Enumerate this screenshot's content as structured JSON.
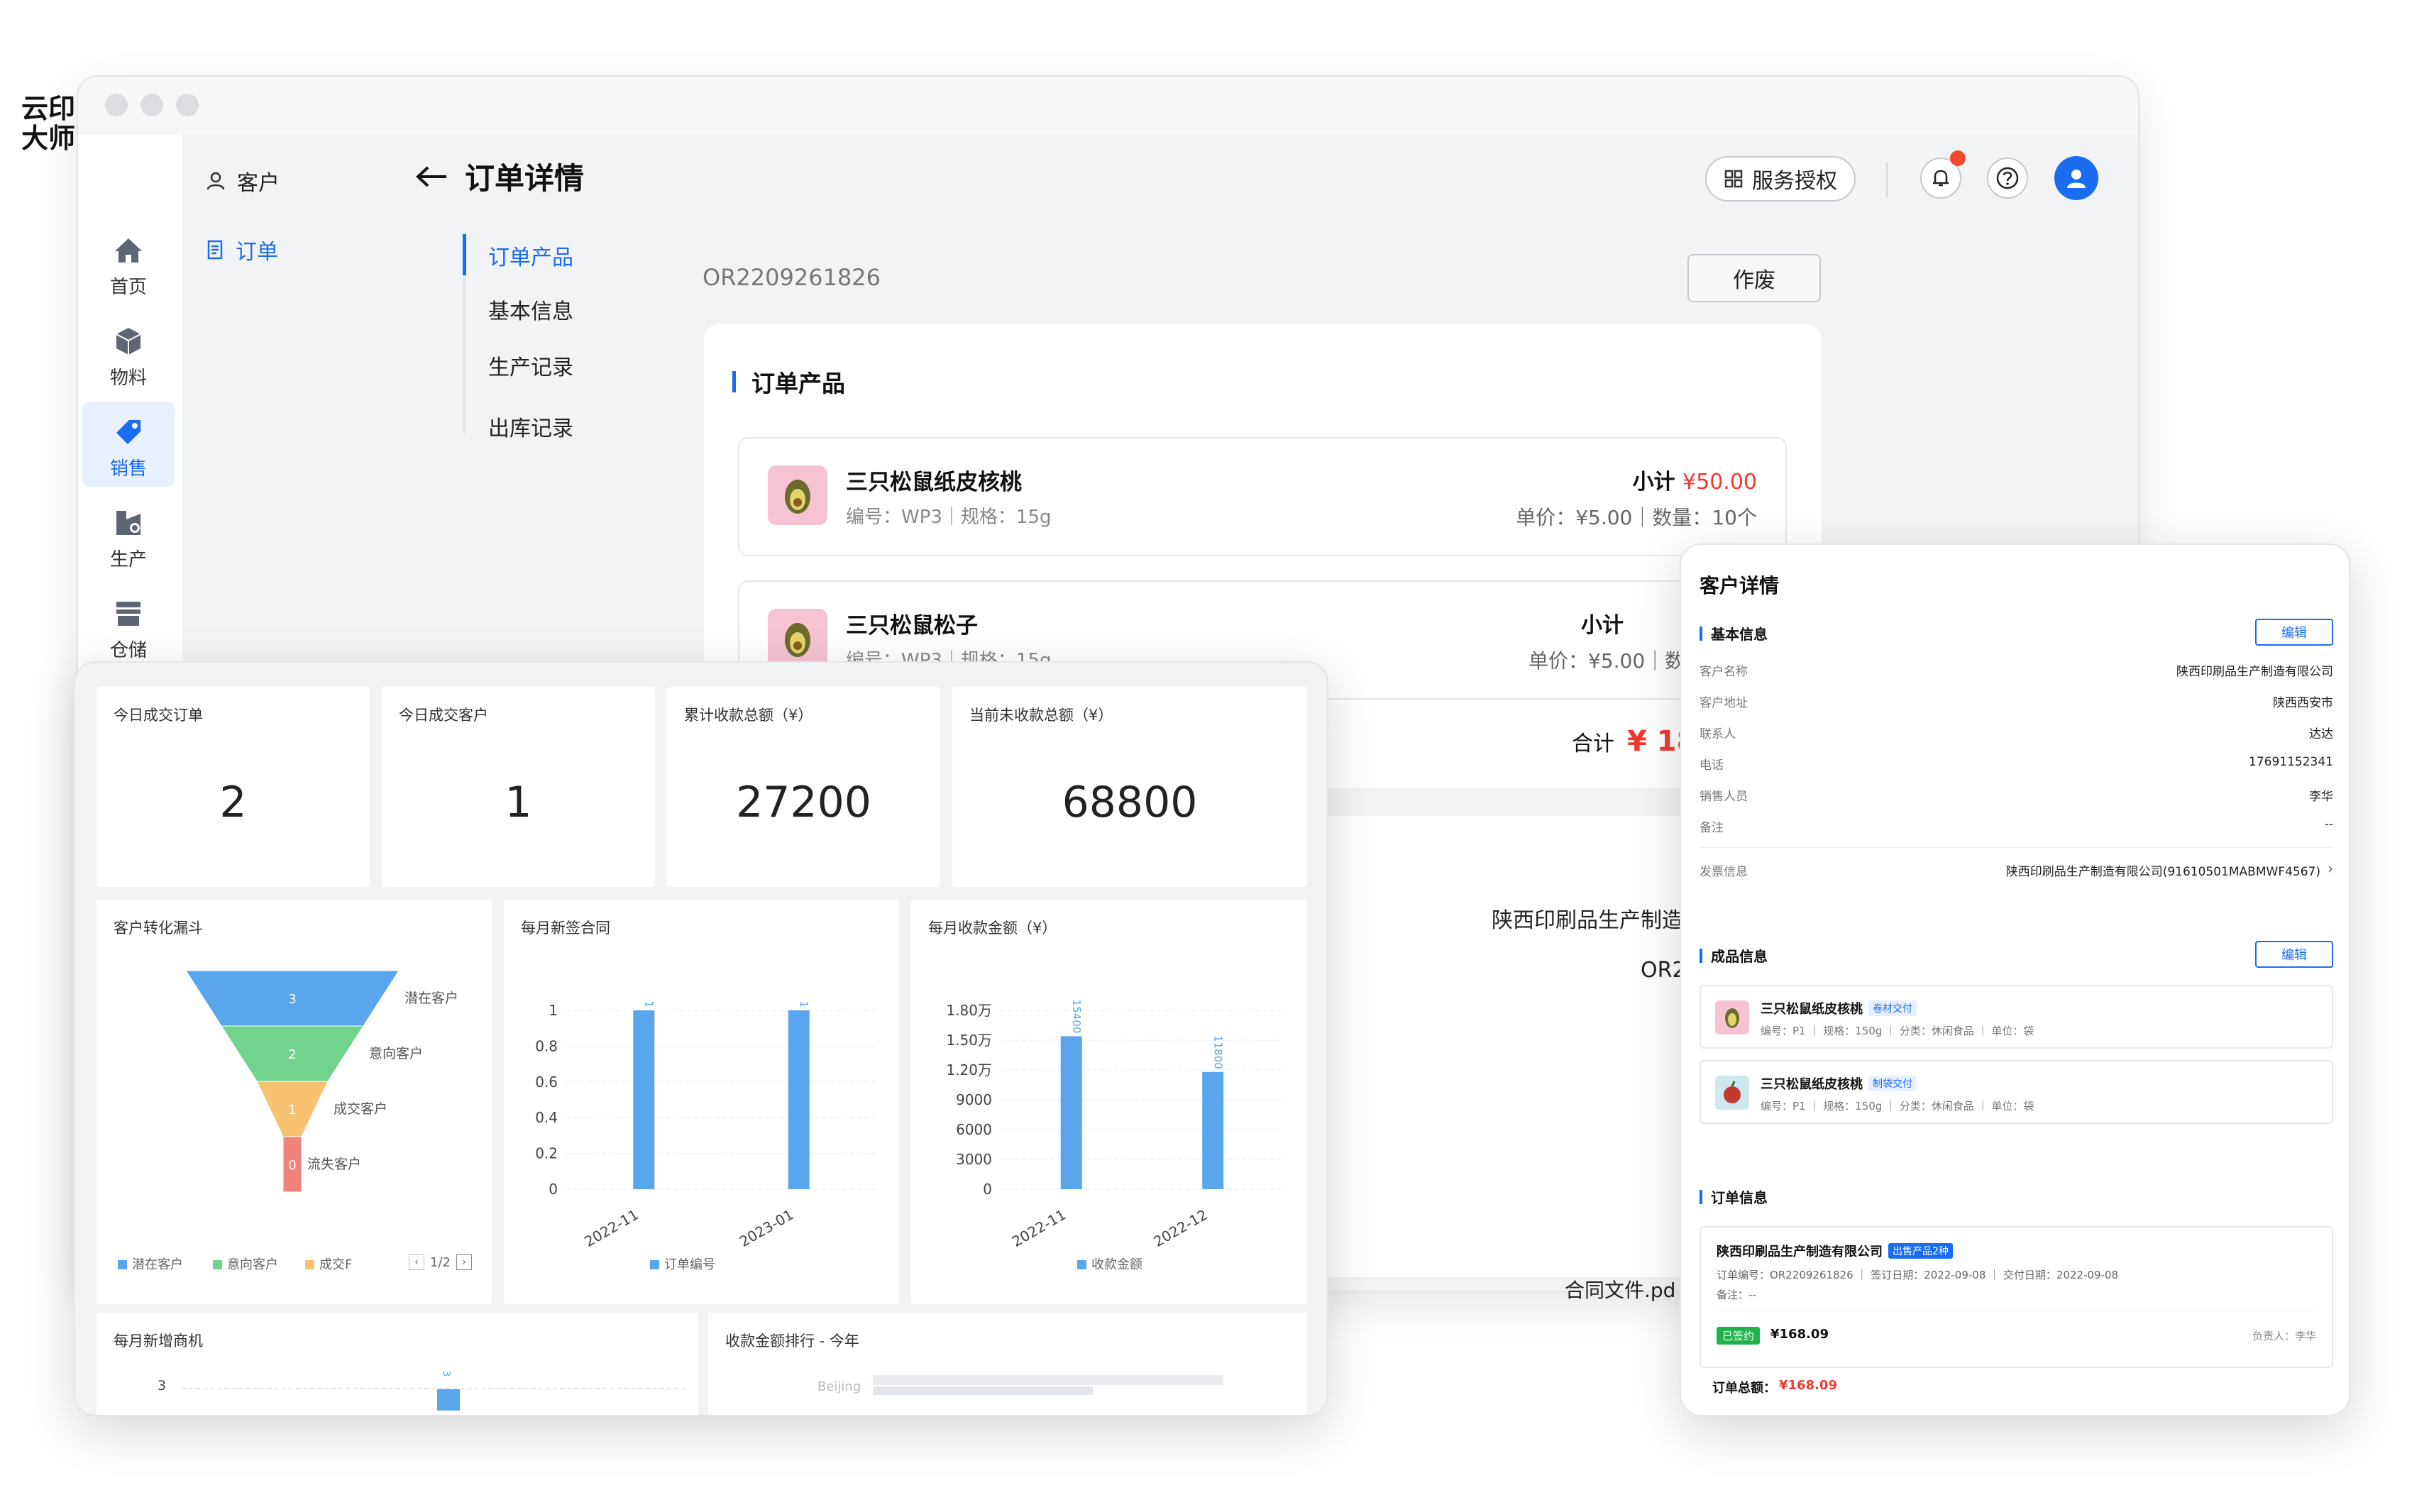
{
  "main": {
    "logo": "云印大师",
    "rail": [
      {
        "label": "首页",
        "icon": "home-icon"
      },
      {
        "label": "物料",
        "icon": "cube-icon"
      },
      {
        "label": "销售",
        "icon": "tag-icon"
      },
      {
        "label": "生产",
        "icon": "factory-icon"
      },
      {
        "label": "仓储",
        "icon": "store-icon"
      }
    ],
    "subnav": {
      "customer": "客户",
      "order": "订单"
    },
    "page_title": "订单详情",
    "anchors": [
      "订单产品",
      "基本信息",
      "生产记录",
      "出库记录"
    ],
    "service_btn": "服务授权",
    "order_no": "OR2209261826",
    "void_btn": "作废",
    "section_title": "订单产品",
    "products": [
      {
        "name": "三只松鼠纸皮核桃",
        "meta": "编号：WP3｜规格：15g",
        "sub_label": "小计",
        "sub_value": "¥50.00",
        "price": "单价：¥5.00｜数量：10个"
      },
      {
        "name": "三只松鼠松子",
        "meta": "编号：WP3｜规格：15g",
        "sub_label": "小计",
        "sub_value": "",
        "price": "单价：¥5.00｜数"
      }
    ],
    "total_label": "合计",
    "total_value": "¥ 18",
    "company_partial": "陕西印刷品生产制造",
    "order_partial": "OR2",
    "contract_partial": "合同文件.pd"
  },
  "dashboard": {
    "kpis": [
      {
        "label": "今日成交订单",
        "value": "2"
      },
      {
        "label": "今日成交客户",
        "value": "1"
      },
      {
        "label": "累计收款总额（¥）",
        "value": "27200"
      },
      {
        "label": "当前未收款总额（¥）",
        "value": "68800"
      }
    ],
    "funnel_title": "客户转化漏斗",
    "contract_title": "每月新签合同",
    "receipt_title": "每月收款金额（¥）",
    "opportunity_title": "每月新增商机",
    "ranking_title": "收款金额排行 - 今年",
    "ranking_first": "Beijing",
    "funnel_page": "1/2",
    "opportunity_tick": "3",
    "opportunity_value": "3"
  },
  "chart_data": [
    {
      "type": "funnel",
      "title": "客户转化漏斗",
      "categories": [
        "潜在客户",
        "意向客户",
        "成交客户",
        "流失客户"
      ],
      "values": [
        3,
        2,
        1,
        0
      ],
      "legend": [
        "潜在客户",
        "意向客户",
        "成交F"
      ],
      "colors": [
        "#5aa6ec",
        "#72d38d",
        "#f7c372",
        "#f0837c"
      ]
    },
    {
      "type": "bar",
      "title": "每月新签合同",
      "categories": [
        "2022-11",
        "2023-01"
      ],
      "series": [
        {
          "name": "订单编号",
          "values": [
            1,
            1
          ]
        }
      ],
      "ylim": [
        0,
        1
      ],
      "yticks": [
        "0",
        "0.2",
        "0.4",
        "0.6",
        "0.8",
        "1"
      ]
    },
    {
      "type": "bar",
      "title": "每月收款金额（¥）",
      "categories": [
        "2022-11",
        "2022-12"
      ],
      "series": [
        {
          "name": "收款金额",
          "values": [
            15400,
            11800
          ]
        }
      ],
      "ylim": [
        0,
        18000
      ],
      "yticks": [
        "0",
        "3000",
        "6000",
        "9000",
        "1.20万",
        "1.50万",
        "1.80万"
      ]
    }
  ],
  "customer": {
    "title": "客户详情",
    "basic_title": "基本信息",
    "edit": "编辑",
    "fields": [
      {
        "k": "客户名称",
        "v": "陕西印刷品生产制造有限公司"
      },
      {
        "k": "客户地址",
        "v": "陕西西安市"
      },
      {
        "k": "联系人",
        "v": "达达"
      },
      {
        "k": "电话",
        "v": "17691152341"
      },
      {
        "k": "销售人员",
        "v": "李华"
      },
      {
        "k": "备注",
        "v": "--"
      }
    ],
    "invoice_k": "发票信息",
    "invoice_v": "陕西印刷品生产制造有限公司(91610501MABMWF4567)",
    "goods_title": "成品信息",
    "goods": [
      {
        "name": "三只松鼠纸皮核桃",
        "tag": "卷材交付",
        "meta": "编号：P1 ｜ 规格：150g ｜ 分类：休闲食品 ｜ 单位：袋"
      },
      {
        "name": "三只松鼠纸皮核桃",
        "tag": "制袋交付",
        "meta": "编号：P1 ｜ 规格：150g ｜ 分类：休闲食品 ｜ 单位：袋"
      }
    ],
    "order_title": "订单信息",
    "order_company": "陕西印刷品生产制造有限公司",
    "order_tag": "出售产品2种",
    "order_meta": "订单编号：OR2209261826 ｜ 签订日期：2022-09-08 ｜ 交付日期：2022-09-08",
    "order_note": "备注：--",
    "order_status": "已签约",
    "order_amount": "¥168.09",
    "order_owner": "负责人：李华",
    "order_total_label": "订单总额：",
    "order_total_value": "¥168.09"
  }
}
